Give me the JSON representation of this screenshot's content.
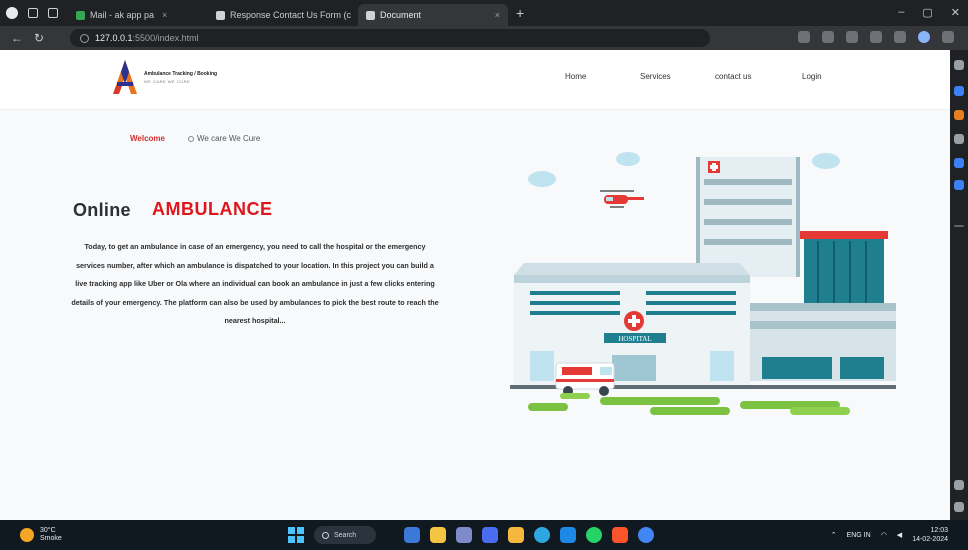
{
  "browser": {
    "tabs": [
      {
        "label": "Mail - ak app pa",
        "active": false
      },
      {
        "label": "Response Contact Us Form (c",
        "active": false
      },
      {
        "label": "Document",
        "active": true
      }
    ],
    "url_host": "127.0.0.1",
    "url_path": ":5500/index.html"
  },
  "site": {
    "logo_title": "Ambulance Tracking / Booking",
    "logo_subtitle": "WE CARE WE CURE",
    "nav": [
      "Home",
      "Services",
      "contact us",
      "Login"
    ],
    "welcome": "Welcome",
    "tagline": "We care We Cure",
    "heading_part1": "Online",
    "heading_part2": "AMBULANCE",
    "description": "Today, to get an ambulance in case of an emergency, you need to call the hospital or the emergency services number, after which an ambulance is dispatched to your location. In this project you can build a live tracking app like Uber or Ola where an individual can book an ambulance in just a few clicks entering details of your emergency. The platform can also be used by ambulances to pick the best route to reach the nearest hospital...",
    "hospital_sign": "HOSPITAL"
  },
  "taskbar": {
    "weather_temp": "30°C",
    "weather_cond": "Smoke",
    "search_label": "Search",
    "lang": "ENG IN",
    "time": "12:03",
    "date": "14-02-2024"
  },
  "colors": {
    "accent_red": "#e0151c",
    "heading_dark": "#2b2f36",
    "grass": "#7cc242",
    "building_teal": "#1f7f8f"
  }
}
